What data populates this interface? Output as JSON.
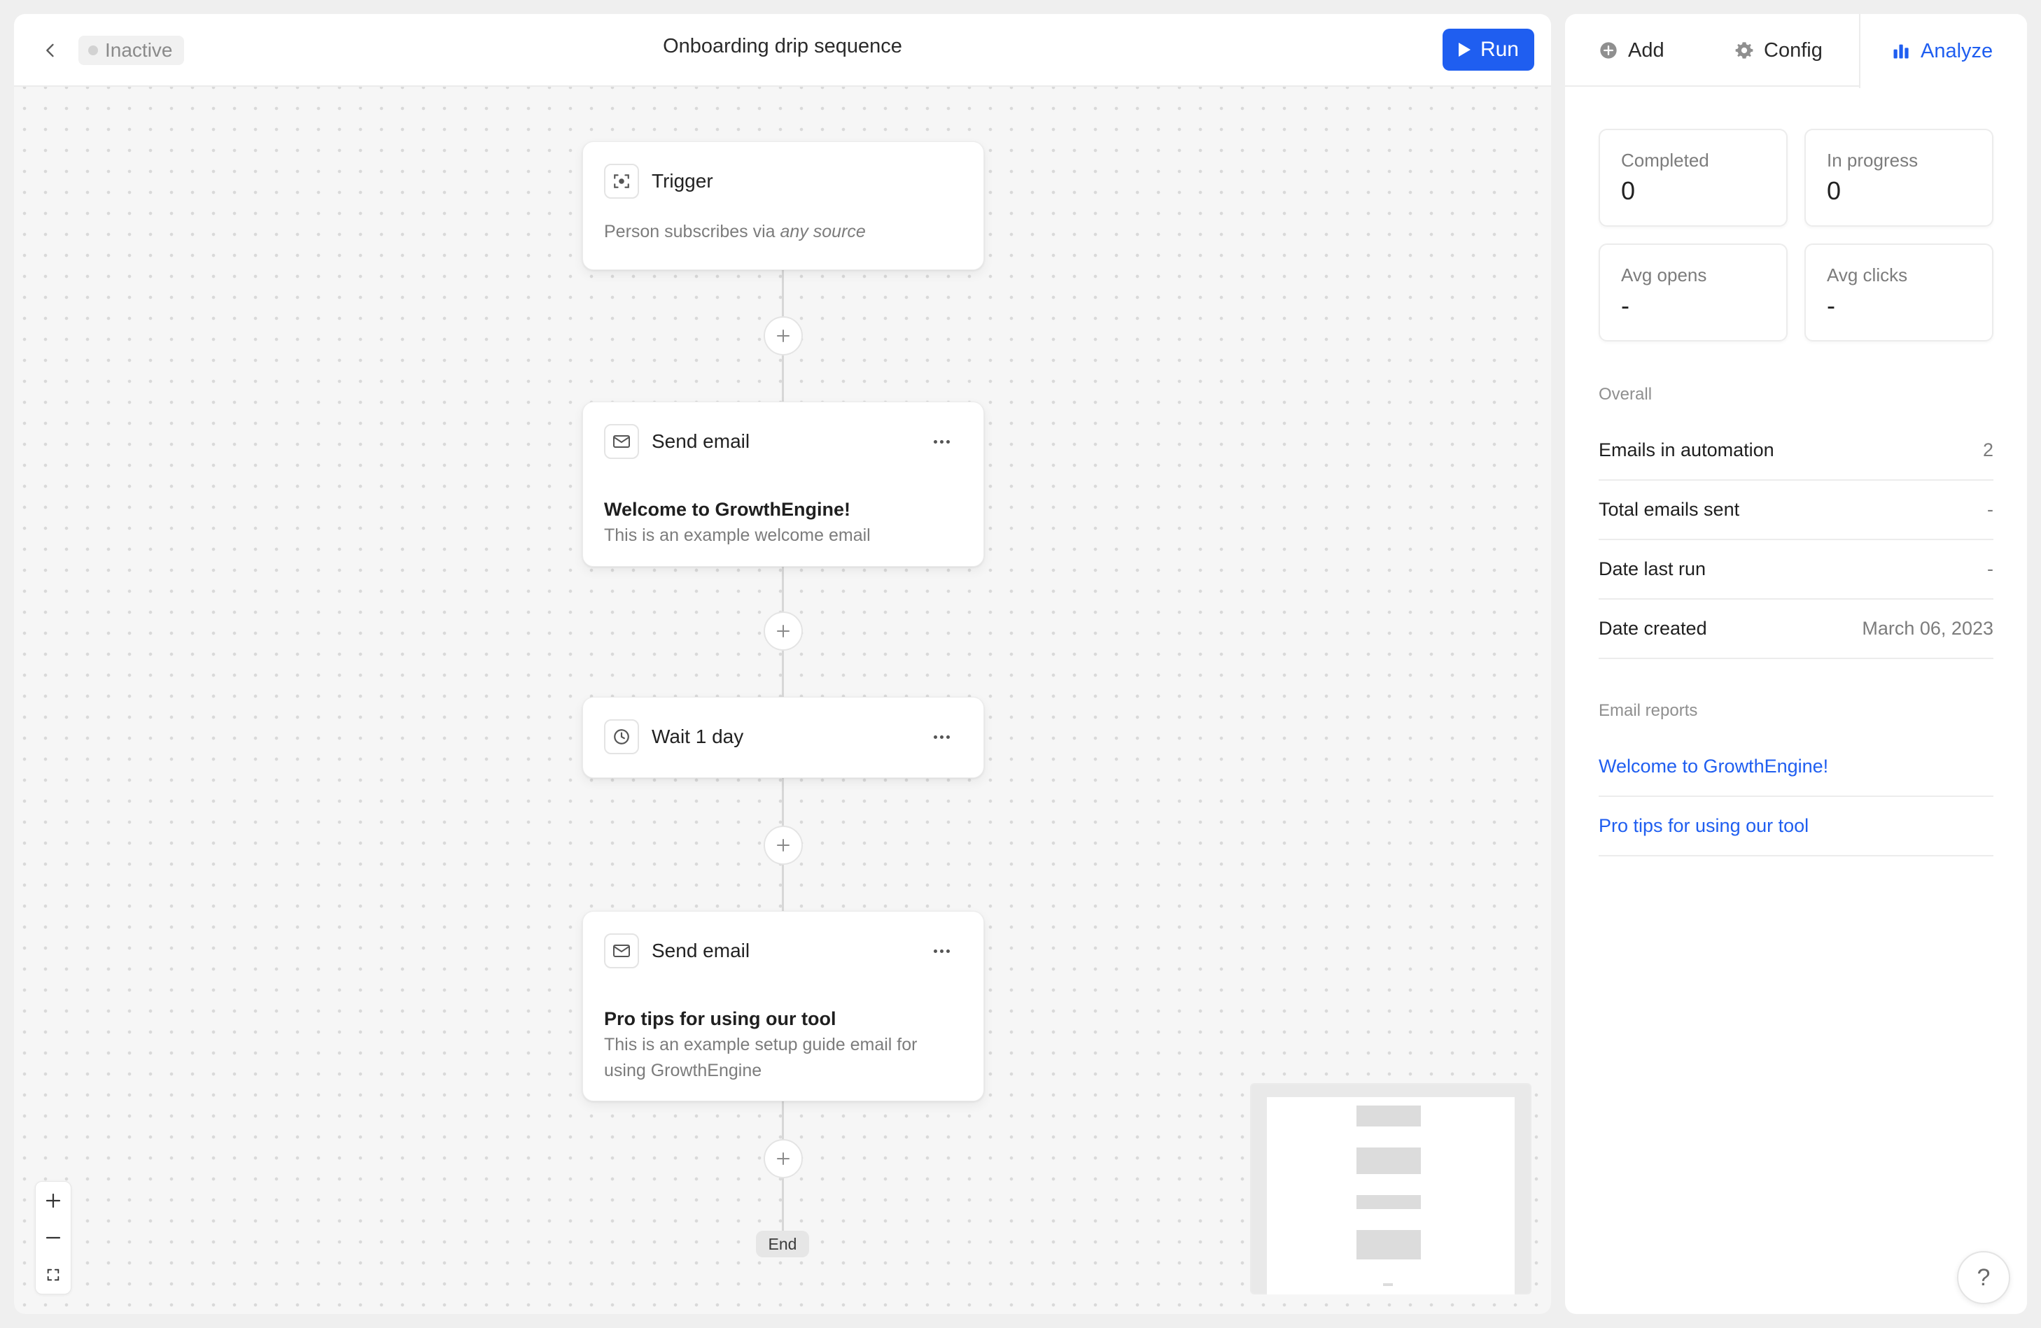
{
  "header": {
    "status": "Inactive",
    "title": "Onboarding drip sequence",
    "run_label": "Run"
  },
  "flow": {
    "trigger": {
      "title": "Trigger",
      "desc_prefix": "Person subscribes via",
      "desc_source": "any source"
    },
    "step1": {
      "type": "Send email",
      "email_title": "Welcome to GrowthEngine!",
      "desc": "This is an example welcome email"
    },
    "step2": {
      "type": "Wait 1 day"
    },
    "step3": {
      "type": "Send email",
      "email_title": "Pro tips for using our tool",
      "desc_line1": "This is an example setup guide email for",
      "desc_line2": "using GrowthEngine"
    },
    "end_label": "End"
  },
  "tabs": {
    "add": "Add",
    "config": "Config",
    "analyze": "Analyze"
  },
  "stats": {
    "completed": {
      "label": "Completed",
      "value": "0"
    },
    "in_progress": {
      "label": "In progress",
      "value": "0"
    },
    "avg_opens": {
      "label": "Avg opens",
      "value": "-"
    },
    "avg_clicks": {
      "label": "Avg clicks",
      "value": "-"
    }
  },
  "overall": {
    "section_label": "Overall",
    "rows": [
      {
        "key": "Emails in automation",
        "value": "2"
      },
      {
        "key": "Total emails sent",
        "value": "-"
      },
      {
        "key": "Date last run",
        "value": "-"
      },
      {
        "key": "Date created",
        "value": "March 06, 2023"
      }
    ]
  },
  "reports": {
    "section_label": "Email reports",
    "items": [
      "Welcome to GrowthEngine!",
      "Pro tips for using our tool"
    ]
  },
  "help_label": "?",
  "colors": {
    "accent": "#1f5ef0",
    "canvas_bg": "#f6f6f6",
    "dot": "#d9d9d9",
    "muted_text": "#7c7c7c"
  }
}
